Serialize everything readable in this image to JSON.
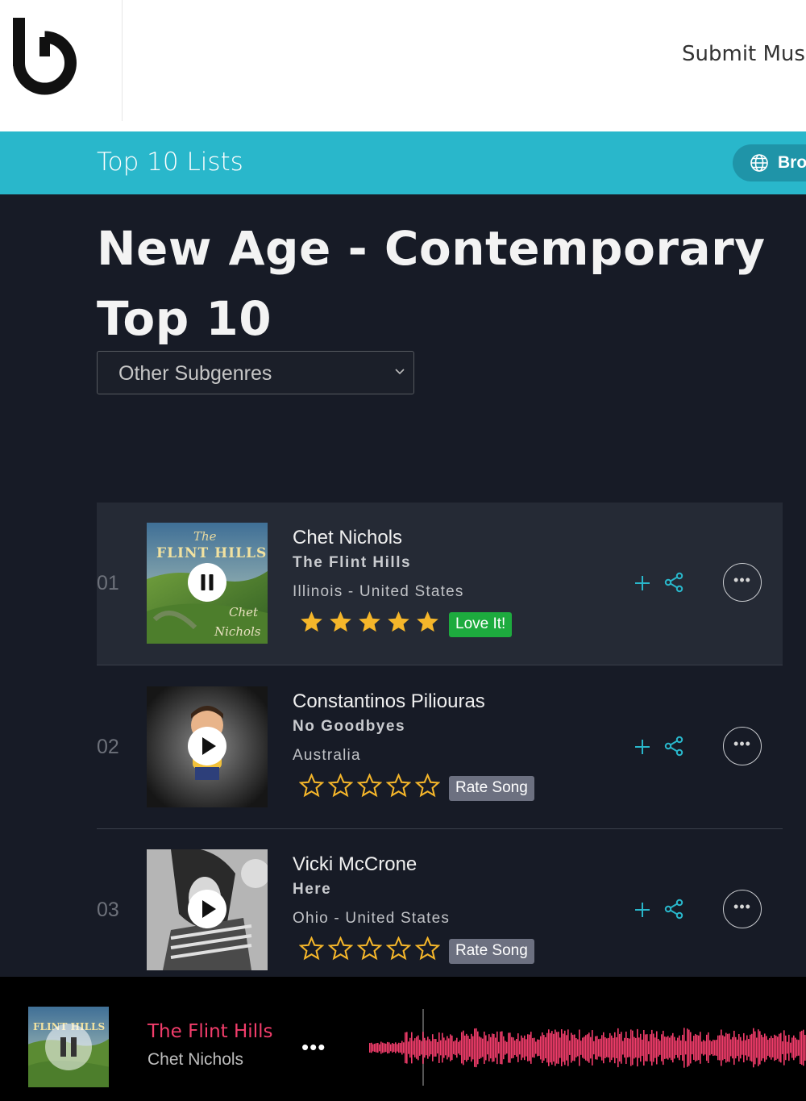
{
  "header": {
    "nav_link": "Submit Musi"
  },
  "band": {
    "title": "Top 10 Lists",
    "browse_label": "Bro"
  },
  "page": {
    "title": "New Age - Contemporary Top 10",
    "subgenre_select": "Other Subgenres"
  },
  "tracks": [
    {
      "rank": "01",
      "artist": "Chet Nichols",
      "song": "The Flint Hills",
      "location": "Illinois - United States",
      "rating": 5,
      "badge": "Love It!",
      "state": "playing"
    },
    {
      "rank": "02",
      "artist": "Constantinos Piliouras",
      "song": "No Goodbyes",
      "location": "Australia",
      "rating": 0,
      "badge": "Rate Song",
      "state": "paused"
    },
    {
      "rank": "03",
      "artist": "Vicki McCrone",
      "song": "Here",
      "location": "Ohio - United States",
      "rating": 0,
      "badge": "Rate Song",
      "state": "paused"
    }
  ],
  "more_label": "•••",
  "player": {
    "song": "The Flint Hills",
    "artist": "Chet Nichols",
    "dots": "•••"
  },
  "colors": {
    "accent": "#29b7cb",
    "love": "#1dab3e",
    "star": "#f5b62a",
    "player_song": "#f23d6b"
  },
  "icons": [
    "brand-logo-icon",
    "globe-icon",
    "chevron-down-icon",
    "pause-icon",
    "play-icon",
    "star-icon",
    "plus-icon",
    "share-icon",
    "more-icon",
    "waveform-icon"
  ]
}
